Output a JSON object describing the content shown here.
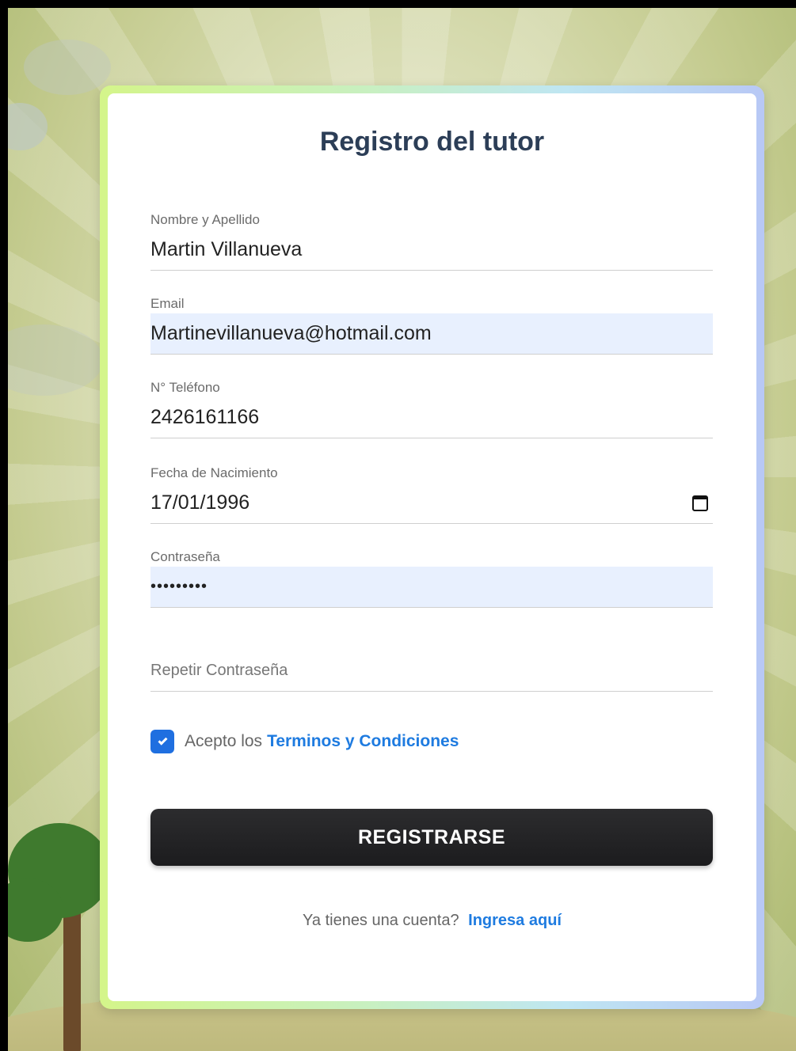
{
  "form": {
    "title": "Registro del tutor",
    "fields": [
      {
        "label": "Nombre y Apellido",
        "value": "Martin Villanueva"
      },
      {
        "label": "Email",
        "value": "Martinevillanueva@hotmail.com"
      },
      {
        "label": "N° Teléfono",
        "value": "2426161166"
      },
      {
        "label": "Fecha de Nacimiento",
        "value": "17/01/1996"
      },
      {
        "label": "Contraseña",
        "value": "•••••••••"
      },
      {
        "label": "",
        "placeholder": "Repetir Contraseña",
        "value": ""
      }
    ],
    "terms": {
      "prefix": "Acepto los",
      "link": "Terminos y Condiciones",
      "checked": true
    },
    "submit_label": "REGISTRARSE",
    "footer": {
      "text": "Ya tienes una cuenta?",
      "link": "Ingresa aquí"
    }
  },
  "colors": {
    "link": "#1e7be0",
    "button": "#1c1c1e",
    "title": "#2c3e57",
    "autofill": "#e8f0fe"
  }
}
